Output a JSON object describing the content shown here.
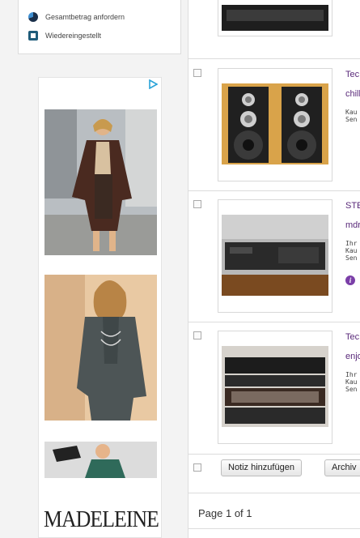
{
  "legend": {
    "items": [
      {
        "label": "Gesamtbetrag anfordern",
        "icon": "pie-chart-icon"
      },
      {
        "label": "Wiedereingestellt",
        "icon": "restore-icon"
      }
    ]
  },
  "ad": {
    "brand": "MADELEINE",
    "choices_icon": "ad-choices-icon"
  },
  "items": [
    {
      "title": "Tec",
      "seller": "chill",
      "meta": "Kau\nSen",
      "info": false
    },
    {
      "title": "STE",
      "seller": "mdr",
      "meta": "Ihr\nKau\nSen",
      "info": true
    },
    {
      "title": "Tec",
      "seller": "enjo",
      "meta": "Ihr\nKau\nSen",
      "info": false
    }
  ],
  "actions": {
    "add_note": "Notiz hinzufügen",
    "archive": "Archiv"
  },
  "pagination": {
    "label": "Page 1 of 1"
  },
  "colors": {
    "link": "#5a2a7a",
    "info": "#7b3fa8"
  }
}
